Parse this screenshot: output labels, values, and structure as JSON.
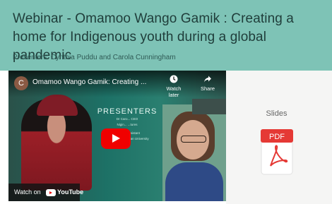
{
  "header": {
    "title": "Webinar - Omamoo Wango Gamik : Creating a home for Indigenous youth during a global pandemic",
    "presenters": "Presenters: Cynthia Puddu and Carola Cunningham"
  },
  "video": {
    "channel_initial": "C",
    "title": "Omamoo Wango Gamik: Creating ...",
    "watch_later": "Watch later",
    "share": "Share",
    "watch_on": "Watch on",
    "youtube": "YouTube",
    "slide": {
      "title": "PRESENTERS",
      "line1": "Dr Caro... CEO",
      "line2": "Nigin... ...tures",
      "line3": "Dr Cyn... ...sistant",
      "line4": "Professor MacEwan University"
    }
  },
  "slides_panel": {
    "label": "Slides",
    "pdf_label": "PDF"
  },
  "colors": {
    "header_bg": "#7ec3b6",
    "play_button": "#f00000",
    "pdf_red": "#e53935"
  }
}
